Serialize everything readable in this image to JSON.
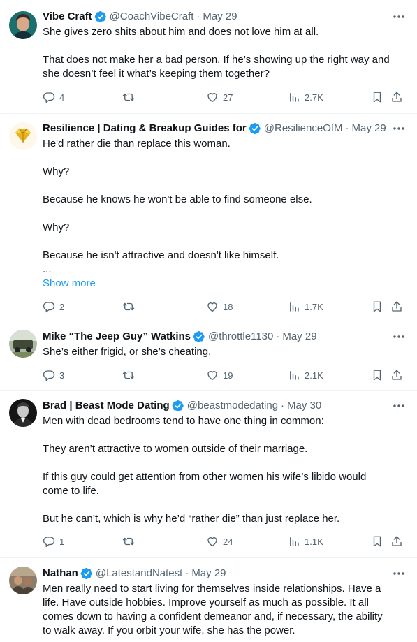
{
  "tweets": [
    {
      "name": "Vibe Craft",
      "handle": "@CoachVibeCraft",
      "date": "May 29",
      "lines": [
        "She gives zero shits about him and does not love him at all.",
        "",
        "That does not make her a bad person. If he’s showing up the right way and",
        "she doesn’t feel it what’s keeping them together?"
      ],
      "show_more": "",
      "replies": "4",
      "retweets": "",
      "likes": "27",
      "views": "2.7K"
    },
    {
      "name": "Resilience | Dating & Breakup Guides for",
      "handle": "@ResilienceOfM",
      "date": "May 29",
      "lines": [
        "He'd rather die than replace this woman.",
        "",
        "Why?",
        "",
        "Because he knows he won't be able to find someone else.",
        "",
        "Why?",
        "",
        "Because he isn't attractive and doesn't like himself.",
        "..."
      ],
      "show_more": "Show more",
      "replies": "2",
      "retweets": "",
      "likes": "18",
      "views": "1.7K"
    },
    {
      "name": "Mike “The Jeep Guy” Watkins",
      "handle": "@throttle1130",
      "date": "May 29",
      "lines": [
        "She’s either frigid, or she’s cheating."
      ],
      "show_more": "",
      "replies": "3",
      "retweets": "",
      "likes": "19",
      "views": "2.1K"
    },
    {
      "name": "Brad | Beast Mode Dating",
      "handle": "@beastmodedating",
      "date": "May 30",
      "lines": [
        "Men with dead bedrooms tend to have one thing in common:",
        "",
        "They aren’t attractive to women outside of their marriage.",
        "",
        "If this guy could get attention from other women his wife’s libido would",
        "come to life.",
        "",
        "But he can’t, which is why he’d “rather die” than just replace her."
      ],
      "show_more": "",
      "replies": "1",
      "retweets": "",
      "likes": "24",
      "views": "1.1K"
    },
    {
      "name": "Nathan",
      "handle": "@LatestandNatest",
      "date": "May 29",
      "lines": [
        "Men really need to start living for themselves inside relationships. Have a",
        "life. Have outside hobbies. Improve yourself as much as possible. It all",
        "comes down to having a confident demeanor and, if necessary, the ability",
        "to walk away. If you orbit your wife, she has the power."
      ],
      "show_more": "",
      "replies": "",
      "retweets": "",
      "likes": "",
      "views": ""
    }
  ],
  "icons": {
    "verified": "verified-badge-icon",
    "more": "more-horizontal-icon",
    "reply": "reply-icon",
    "retweet": "retweet-icon",
    "like": "heart-icon",
    "views": "views-chart-icon",
    "bookmark": "bookmark-icon",
    "share": "share-icon"
  },
  "colors": {
    "text": "#0f1419",
    "secondary": "#536471",
    "accent": "#1d9bf0",
    "divider": "#eff3f4"
  }
}
